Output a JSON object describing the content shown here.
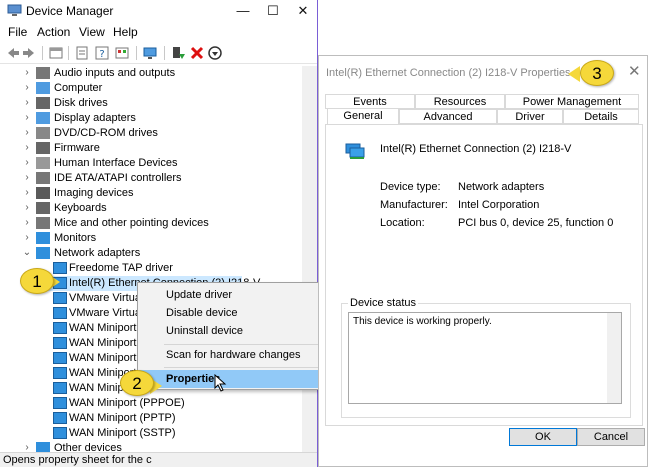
{
  "device_manager": {
    "title": "Device Manager",
    "controls": {
      "minimize": "—",
      "maximize": "☐",
      "close": "✕"
    },
    "menu": [
      "File",
      "Action",
      "View",
      "Help"
    ],
    "toolbar_icons": [
      "back-icon",
      "forward-icon",
      "properties-icon",
      "update-icon",
      "help-icon",
      "view-icon",
      "scan-icon",
      "enable-icon",
      "uninstall-icon",
      "download-icon"
    ],
    "tree": [
      {
        "label": "Audio inputs and outputs",
        "arrow": "›"
      },
      {
        "label": "Computer",
        "arrow": "›"
      },
      {
        "label": "Disk drives",
        "arrow": "›"
      },
      {
        "label": "Display adapters",
        "arrow": "›"
      },
      {
        "label": "DVD/CD-ROM drives",
        "arrow": "›"
      },
      {
        "label": "Firmware",
        "arrow": "›"
      },
      {
        "label": "Human Interface Devices",
        "arrow": "›"
      },
      {
        "label": "IDE ATA/ATAPI controllers",
        "arrow": "›"
      },
      {
        "label": "Imaging devices",
        "arrow": "›"
      },
      {
        "label": "Keyboards",
        "arrow": "›"
      },
      {
        "label": "Mice and other pointing devices",
        "arrow": "›"
      },
      {
        "label": "Monitors",
        "arrow": "›"
      },
      {
        "label": "Network adapters",
        "arrow": "⌄"
      },
      {
        "label": "Freedome TAP driver"
      },
      {
        "label": "Intel(R) Ethernet Connection (2) I218-V"
      },
      {
        "label": "VMware Virtual"
      },
      {
        "label": "VMware Virtual"
      },
      {
        "label": "WAN Miniport ("
      },
      {
        "label": "WAN Miniport ("
      },
      {
        "label": "WAN Miniport ("
      },
      {
        "label": "WAN Miniport ("
      },
      {
        "label": "WAN Miniport ("
      },
      {
        "label": "WAN Miniport (PPPOE)"
      },
      {
        "label": "WAN Miniport (PPTP)"
      },
      {
        "label": "WAN Miniport (SSTP)"
      },
      {
        "label": "Other devices",
        "arrow": "›"
      }
    ],
    "status_bar": "Opens property sheet for the c"
  },
  "context_menu": {
    "items": [
      "Update driver",
      "Disable device",
      "Uninstall device",
      "Scan for hardware changes",
      "Properties"
    ]
  },
  "callouts": [
    "1",
    "2",
    "3"
  ],
  "properties_dialog": {
    "title": "Intel(R) Ethernet Connection (2) I218-V Properties",
    "close": "✕",
    "tabs_back": [
      "Events",
      "Resources",
      "Power Management"
    ],
    "tabs_front": [
      "General",
      "Advanced",
      "Driver",
      "Details"
    ],
    "device_name": "Intel(R) Ethernet Connection (2) I218-V",
    "device_type_label": "Device type:",
    "device_type": "Network adapters",
    "manufacturer_label": "Manufacturer:",
    "manufacturer": "Intel Corporation",
    "location_label": "Location:",
    "location": "PCI bus 0, device 25, function 0",
    "status_legend": "Device status",
    "status_text": "This device is working properly.",
    "ok": "OK",
    "cancel": "Cancel"
  }
}
